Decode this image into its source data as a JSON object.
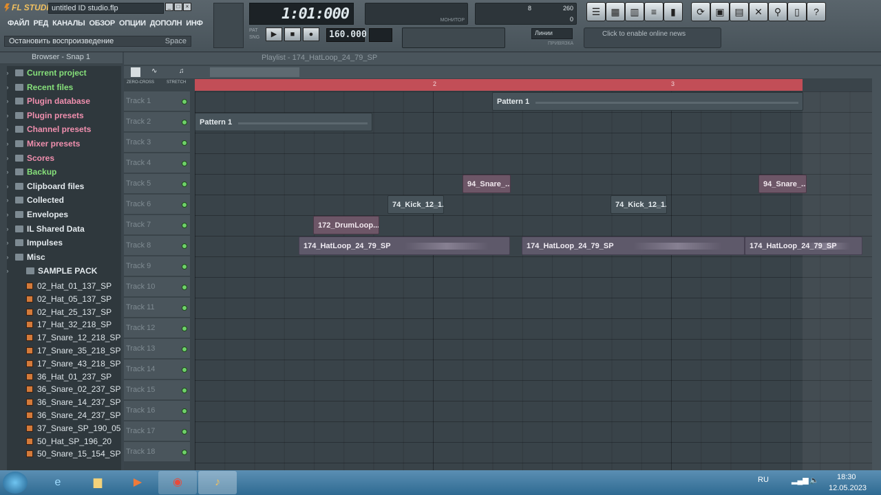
{
  "app": {
    "logo": "FL STUDIO",
    "file_title": "untitled ID studio.flp",
    "window_buttons": [
      "_",
      "□",
      "×"
    ]
  },
  "menu": [
    "ФАЙЛ",
    "РЕД",
    "КАНАЛЫ",
    "ОБЗОР",
    "ОПЦИИ",
    "ДОПОЛН",
    "ИНФ"
  ],
  "hint": {
    "text": "Остановить воспроизведение",
    "key": "Space"
  },
  "transport": {
    "time": "1:01:000",
    "tempo": "160.000",
    "buttons": [
      "▶",
      "■",
      "●"
    ],
    "snap": "Линии",
    "snap_label": "ПРИВЯЗКА"
  },
  "meter": {
    "monitor_label": "МОНИТОР",
    "cpu": "8",
    "mem": "260",
    "poly": "0"
  },
  "news": "Click to enable online news",
  "browser": {
    "title": "Browser - Snap 1",
    "folders": [
      {
        "label": "Current project",
        "color": "green"
      },
      {
        "label": "Recent files",
        "color": "green"
      },
      {
        "label": "Plugin database",
        "color": "pink"
      },
      {
        "label": "Plugin presets",
        "color": "pink"
      },
      {
        "label": "Channel presets",
        "color": "pink"
      },
      {
        "label": "Mixer presets",
        "color": "pink"
      },
      {
        "label": "Scores",
        "color": "pink"
      },
      {
        "label": "Backup",
        "color": "green"
      },
      {
        "label": "Clipboard files",
        "color": "white"
      },
      {
        "label": "Collected",
        "color": "white"
      },
      {
        "label": "Envelopes",
        "color": "white"
      },
      {
        "label": "IL Shared Data",
        "color": "white"
      },
      {
        "label": "Impulses",
        "color": "white"
      },
      {
        "label": "Misc",
        "color": "white"
      },
      {
        "label": "SAMPLE PACK",
        "color": "white"
      }
    ],
    "files": [
      "02_Hat_01_137_SP",
      "02_Hat_05_137_SP",
      "02_Hat_25_137_SP",
      "17_Hat_32_218_SP",
      "17_Snare_12_218_SP",
      "17_Snare_35_218_SP",
      "17_Snare_43_218_SP",
      "36_Hat_01_237_SP",
      "36_Snare_02_237_SP",
      "36_Snare_14_237_SP",
      "36_Snare_24_237_SP",
      "37_Snare_SP_190_05",
      "50_Hat_SP_196_20",
      "50_Snare_15_154_SP"
    ]
  },
  "playlist": {
    "title": "Playlist - 174_HatLoop_24_79_SP",
    "ruler_labels": [
      "2",
      "3"
    ],
    "zero_cross": "ZERO-CROSS",
    "stretch": "STRETCH",
    "tracks": [
      "Track 1",
      "Track 2",
      "Track 3",
      "Track 4",
      "Track 5",
      "Track 6",
      "Track 7",
      "Track 8",
      "Track 9",
      "Track 10",
      "Track 11",
      "Track 12",
      "Track 13",
      "Track 14",
      "Track 15",
      "Track 16",
      "Track 17",
      "Track 18"
    ],
    "clips": [
      {
        "name": "Pattern 1",
        "track": 1,
        "type": "pattern"
      },
      {
        "name": "Pattern 1",
        "track": 2,
        "type": "pattern"
      },
      {
        "name": "94_Snare_...",
        "track": 5,
        "type": "audio"
      },
      {
        "name": "94_Snare_...",
        "track": 5,
        "type": "audio"
      },
      {
        "name": "74_Kick_12_1...",
        "track": 6,
        "type": "pattern"
      },
      {
        "name": "74_Kick_12_1...",
        "track": 6,
        "type": "pattern"
      },
      {
        "name": "172_DrumLoop...",
        "track": 7,
        "type": "audio"
      },
      {
        "name": "174_HatLoop_24_79_SP",
        "track": 8,
        "type": "hat"
      },
      {
        "name": "174_HatLoop_24_79_SP",
        "track": 8,
        "type": "hat"
      },
      {
        "name": "174_HatLoop_24_79_SP",
        "track": 8,
        "type": "hat"
      }
    ]
  },
  "taskbar": {
    "lang": "RU",
    "time": "18:30",
    "date": "12.05.2023"
  },
  "colors": {
    "ruler": "#c24e57",
    "audio_clip": "#6d5667",
    "pattern_clip": "#47535a",
    "green_folder": "#86e07a",
    "pink_folder": "#f08fae"
  }
}
